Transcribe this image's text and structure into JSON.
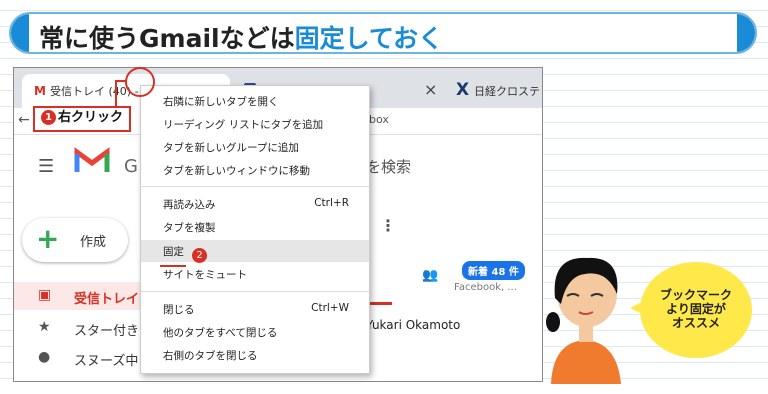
{
  "title": {
    "prefix": "常に使うGmailなどは",
    "highlight": "固定しておく"
  },
  "browser": {
    "tab1_title": "受信トレイ (40) -",
    "tab1_icon": "M",
    "tab3_icon": "X",
    "tab3_title": "日経クロステ",
    "tab_close": "×",
    "address_fragment": "box"
  },
  "gmail": {
    "search_fragment": "を検索",
    "compose_label": "作成",
    "nav": [
      {
        "label": "受信トレイ",
        "icon": "inbox-icon"
      },
      {
        "label": "スター付き",
        "icon": "star-icon"
      },
      {
        "label": "スヌーズ中",
        "icon": "clock-icon"
      }
    ],
    "badge": "新着 48 件",
    "badge_sub": "Facebook, ...",
    "sender": "Yukari Okamoto"
  },
  "context_menu": {
    "items": [
      {
        "label": "右隣に新しいタブを開く",
        "shortcut": ""
      },
      {
        "label": "リーディング リストにタブを追加",
        "shortcut": ""
      },
      {
        "label": "タブを新しいグループに追加",
        "shortcut": ""
      },
      {
        "label": "タブを新しいウィンドウに移動",
        "shortcut": ""
      },
      {
        "label": "再読み込み",
        "shortcut": "Ctrl+R"
      },
      {
        "label": "タブを複製",
        "shortcut": ""
      },
      {
        "label": "固定",
        "shortcut": ""
      },
      {
        "label": "サイトをミュート",
        "shortcut": ""
      },
      {
        "label": "閉じる",
        "shortcut": "Ctrl+W"
      },
      {
        "label": "他のタブをすべて閉じる",
        "shortcut": ""
      },
      {
        "label": "右側のタブを閉じる",
        "shortcut": ""
      }
    ]
  },
  "annotations": {
    "step1_num": "1",
    "step1_label": "右クリック",
    "step2_num": "2"
  },
  "speech_bubble": {
    "line1": "ブックマーク",
    "line2": "より固定が",
    "line3": "オススメ"
  },
  "colors": {
    "accent_blue": "#1a8bd6",
    "callout_red": "#d93025",
    "bubble_yellow": "#ffe84a"
  }
}
